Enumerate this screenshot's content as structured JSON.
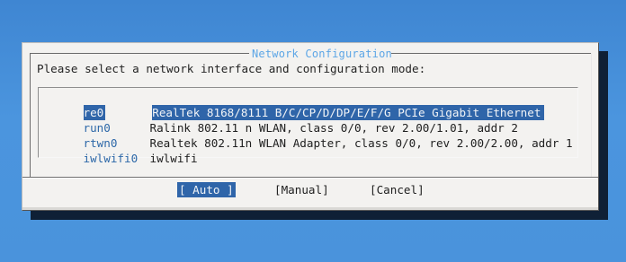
{
  "dialog": {
    "title": "Network Configuration",
    "prompt": "Please select a network interface and configuration mode:"
  },
  "interfaces": [
    {
      "name": "re0",
      "description": "RealTek 8168/8111 B/C/CP/D/DP/E/F/G PCIe Gigabit Ethernet"
    },
    {
      "name": "run0",
      "description": "Ralink 802.11 n WLAN, class 0/0, rev 2.00/1.01, addr 2"
    },
    {
      "name": "rtwn0",
      "description": "Realtek 802.11n WLAN Adapter, class 0/0, rev 2.00/2.00, addr 1"
    },
    {
      "name": "iwlwifi0",
      "description": "iwlwifi"
    }
  ],
  "buttons": {
    "auto": "[ Auto ]",
    "manual": "[Manual]",
    "cancel": "[Cancel]"
  },
  "colors": {
    "background": "#4a93dc",
    "dialog": "#f3f2f0",
    "selection": "#2f65a9",
    "title": "#5da6e6",
    "interface_name": "#2d68a8"
  }
}
